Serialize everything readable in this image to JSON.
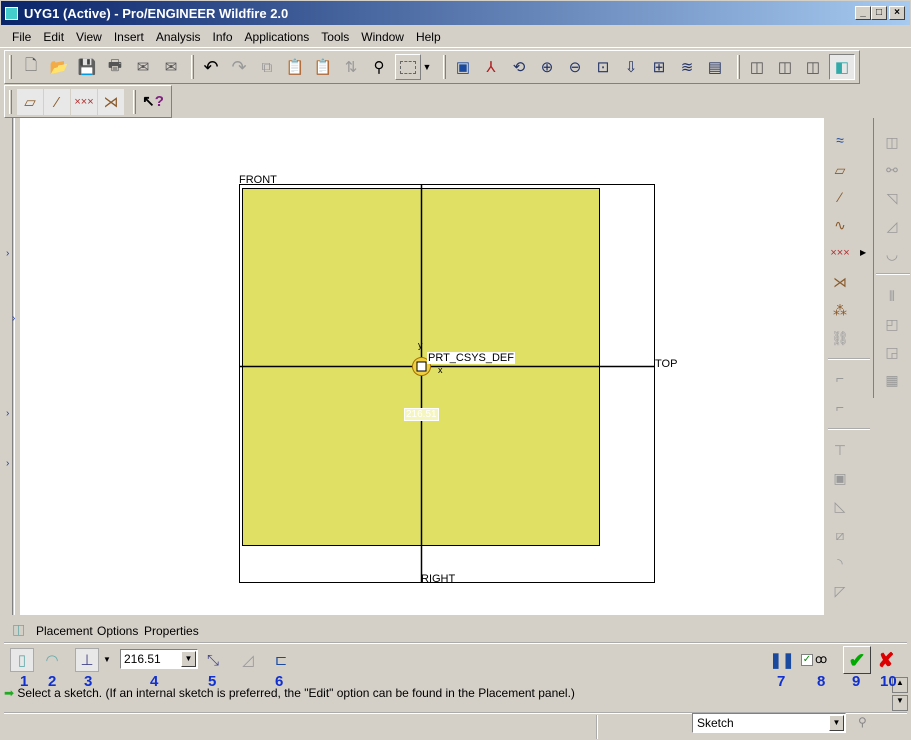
{
  "window": {
    "title": "UYG1 (Active) - Pro/ENGINEER Wildfire 2.0",
    "min": "_",
    "max": "□",
    "close": "×"
  },
  "menu": [
    "File",
    "Edit",
    "View",
    "Insert",
    "Analysis",
    "Info",
    "Applications",
    "Tools",
    "Window",
    "Help"
  ],
  "toolbar1": {
    "file_icons": [
      "new-icon",
      "open-icon",
      "save-icon",
      "print-icon",
      "send-mail-icon",
      "send-link-icon"
    ],
    "edit_icons": [
      "undo-icon",
      "redo-icon",
      "copy-icon",
      "paste-icon",
      "paste-special-icon",
      "regenerate-icon",
      "find-icon",
      "select-box-icon"
    ],
    "view_icons": [
      "repaint-icon",
      "spin-center-icon",
      "orient-icon",
      "zoom-in-icon",
      "zoom-out-icon",
      "refit-icon",
      "reorient-icon",
      "view-manager-icon",
      "layers-icon",
      "saved-views-icon"
    ],
    "display_icons": [
      "wireframe-icon",
      "hidden-line-icon",
      "no-hidden-icon",
      "shading-icon"
    ]
  },
  "toolbar2": {
    "icons": [
      "datum-planes-icon",
      "datum-axes-icon",
      "datum-points-icon",
      "csys-icon"
    ],
    "help_icon": "whats-this-icon",
    "help_label": "?"
  },
  "canvas": {
    "plane_front": "FRONT",
    "plane_top": "TOP",
    "plane_right": "RIGHT",
    "csys": "PRT_CSYS_DEF",
    "axis_y": "y",
    "axis_x": "x",
    "depth_label": "216.51",
    "fill_color": "#e0e065"
  },
  "dashboard": {
    "tabs": [
      "Placement",
      "Options",
      "Properties"
    ],
    "depth_value": "216.51",
    "annotations": [
      "1",
      "2",
      "3",
      "4",
      "5",
      "6",
      "7",
      "8",
      "9",
      "10"
    ],
    "message": "Select a sketch. (If an internal sketch is preferred, the \"Edit\" option can be found in the Placement panel.)",
    "filter_value": "Sketch"
  }
}
